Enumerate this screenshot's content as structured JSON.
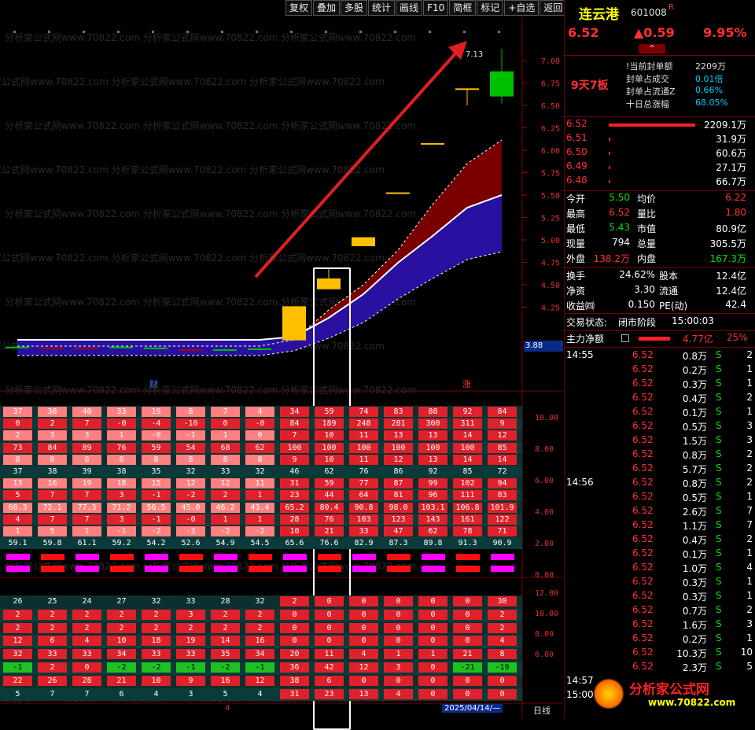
{
  "toolbar": {
    "items": [
      "复权",
      "叠加",
      "多股",
      "统计",
      "画线",
      "F10",
      "简框",
      "标记",
      "+自选",
      "返回"
    ]
  },
  "stock": {
    "name": "连云港",
    "code": "601008",
    "flag": "R",
    "price": "6.52",
    "change": "▲0.59",
    "pct": "9.95%"
  },
  "board": {
    "label": "9天7板",
    "rows": [
      {
        "k": "!当前封单额",
        "v": "2209万"
      },
      {
        "k": "封单占成交",
        "v": "0.01倍"
      },
      {
        "k": "封单占流通Z",
        "v": "0.66%"
      },
      {
        "k": "十日总涨幅",
        "v": "68.05%"
      }
    ]
  },
  "orderbook": [
    {
      "price": "6.52",
      "vol": "2209.1万"
    },
    {
      "price": "6.51",
      "vol": "31.9万"
    },
    {
      "price": "6.50",
      "vol": "60.6万"
    },
    {
      "price": "6.49",
      "vol": "27.1万"
    },
    {
      "price": "6.48",
      "vol": "66.7万"
    }
  ],
  "quote": [
    {
      "k1": "今开",
      "v1": "5.50",
      "k2": "均价",
      "v2": "6.22"
    },
    {
      "k1": "最高",
      "v1": "6.52",
      "k2": "量比",
      "v2": "1.80"
    },
    {
      "k1": "最低",
      "v1": "5.43",
      "k2": "市值",
      "v2": "80.9亿"
    },
    {
      "k1": "现量",
      "v1": "794",
      "k2": "总量",
      "v2": "305.5万"
    },
    {
      "k1": "外盘",
      "v1": "138.2万",
      "k2": "内盘",
      "v2": "167.3万"
    }
  ],
  "fund": [
    {
      "k1": "换手",
      "v1": "24.62%",
      "k2": "股本",
      "v2": "12.4亿"
    },
    {
      "k1": "净资",
      "v1": "3.30",
      "k2": "流通",
      "v2": "12.4亿"
    },
    {
      "k1": "收益㈣",
      "v1": "0.150",
      "k2": "PE(动)",
      "v2": "42.4"
    }
  ],
  "status": {
    "label": "交易状态:",
    "value": "闭市阶段",
    "time": "15:00:03"
  },
  "mainflow": {
    "label": "主力净额",
    "value": "4.77亿",
    "pct": "25%"
  },
  "ticks": [
    {
      "t": "14:55",
      "p": "6.52",
      "v": "0.8万",
      "s": "S",
      "n": "2"
    },
    {
      "t": "",
      "p": "6.52",
      "v": "0.2万",
      "s": "S",
      "n": "1"
    },
    {
      "t": "",
      "p": "6.52",
      "v": "0.3万",
      "s": "S",
      "n": "1"
    },
    {
      "t": "",
      "p": "6.52",
      "v": "0.4万",
      "s": "S",
      "n": "2"
    },
    {
      "t": "",
      "p": "6.52",
      "v": "0.1万",
      "s": "S",
      "n": "1"
    },
    {
      "t": "",
      "p": "6.52",
      "v": "0.5万",
      "s": "S",
      "n": "3"
    },
    {
      "t": "",
      "p": "6.52",
      "v": "1.5万",
      "s": "S",
      "n": "3"
    },
    {
      "t": "",
      "p": "6.52",
      "v": "0.8万",
      "s": "S",
      "n": "2"
    },
    {
      "t": "",
      "p": "6.52",
      "v": "5.7万",
      "s": "S",
      "n": "2"
    },
    {
      "t": "14:56",
      "p": "6.52",
      "v": "0.8万",
      "s": "S",
      "n": "2"
    },
    {
      "t": "",
      "p": "6.52",
      "v": "0.5万",
      "s": "S",
      "n": "1"
    },
    {
      "t": "",
      "p": "6.52",
      "v": "2.6万",
      "s": "S",
      "n": "7"
    },
    {
      "t": "",
      "p": "6.52",
      "v": "1.1万",
      "s": "S",
      "n": "7"
    },
    {
      "t": "",
      "p": "6.52",
      "v": "0.4万",
      "s": "S",
      "n": "2"
    },
    {
      "t": "",
      "p": "6.52",
      "v": "0.1万",
      "s": "S",
      "n": "1"
    },
    {
      "t": "",
      "p": "6.52",
      "v": "1.0万",
      "s": "S",
      "n": "4"
    },
    {
      "t": "",
      "p": "6.52",
      "v": "0.3万",
      "s": "S",
      "n": "1"
    },
    {
      "t": "",
      "p": "6.52",
      "v": "0.3万",
      "s": "S",
      "n": "1"
    },
    {
      "t": "",
      "p": "6.52",
      "v": "0.7万",
      "s": "S",
      "n": "2"
    },
    {
      "t": "",
      "p": "6.52",
      "v": "1.6万",
      "s": "S",
      "n": "3"
    },
    {
      "t": "",
      "p": "6.52",
      "v": "0.2万",
      "s": "S",
      "n": "1"
    },
    {
      "t": "",
      "p": "6.52",
      "v": "10.3万",
      "s": "S",
      "n": "10"
    },
    {
      "t": "",
      "p": "6.52",
      "v": "2.3万",
      "s": "S",
      "n": "5"
    },
    {
      "t": "14:57",
      "p": "",
      "v": "",
      "s": "",
      "n": ""
    },
    {
      "t": "15:00",
      "p": "",
      "v": "",
      "s": "",
      "n": ""
    }
  ],
  "price_axis": [
    "7.00",
    "6.75",
    "6.50",
    "6.25",
    "6.00",
    "5.75",
    "5.50",
    "5.25",
    "5.00",
    "4.75",
    "4.50",
    "4.25"
  ],
  "price_current": "3.88",
  "max_label": "7.13",
  "markers": {
    "cai": "财",
    "zhang": "涨"
  },
  "grid1_axis": [
    "10.00",
    "8.00",
    "6.00",
    "4.00",
    "2.00",
    "0.00"
  ],
  "grid2_axis": [
    "12.00",
    "10.00",
    "8.00",
    "6.00"
  ],
  "grid1": [
    [
      "37",
      "38",
      "40",
      "33",
      "19",
      "8",
      "7",
      "4",
      "34",
      "59",
      "74",
      "83",
      "88",
      "92",
      "84"
    ],
    [
      "0",
      "2",
      "7",
      "-0",
      "-4",
      "-10",
      "0",
      "-0",
      "84",
      "189",
      "248",
      "281",
      "300",
      "311",
      "9"
    ],
    [
      "2",
      "3",
      "3",
      "1",
      "-0",
      "-1",
      "1",
      "0",
      "7",
      "10",
      "11",
      "13",
      "13",
      "14",
      "12"
    ],
    [
      "73",
      "84",
      "89",
      "76",
      "59",
      "54",
      "68",
      "62",
      "100",
      "100",
      "100",
      "100",
      "100",
      "100",
      "85"
    ],
    [
      "8",
      "8",
      "8",
      "8",
      "8",
      "8",
      "8",
      "8",
      "9",
      "10",
      "11",
      "12",
      "13",
      "14",
      "14"
    ],
    [
      "37",
      "38",
      "39",
      "38",
      "35",
      "32",
      "33",
      "32",
      "46",
      "62",
      "76",
      "86",
      "92",
      "85",
      "72"
    ],
    [
      "13",
      "16",
      "19",
      "18",
      "15",
      "12",
      "12",
      "11",
      "31",
      "59",
      "77",
      "87",
      "99",
      "102",
      "94"
    ],
    [
      "5",
      "7",
      "7",
      "3",
      "-1",
      "-2",
      "2",
      "1",
      "23",
      "44",
      "64",
      "81",
      "96",
      "111",
      "83"
    ],
    [
      "68.3",
      "72.1",
      "77.3",
      "71.2",
      "56.5",
      "45.0",
      "46.2",
      "43.4",
      "65.2",
      "80.4",
      "90.8",
      "98.0",
      "103.1",
      "106.8",
      "101.9"
    ],
    [
      "4",
      "7",
      "7",
      "3",
      "-1",
      "-0",
      "1",
      "1",
      "28",
      "76",
      "103",
      "123",
      "143",
      "161",
      "122"
    ],
    [
      "1",
      "5",
      "1",
      "-1",
      "-2",
      "-3",
      "-2",
      "-2",
      "10",
      "21",
      "33",
      "47",
      "62",
      "78",
      "71"
    ],
    [
      "59.1",
      "59.8",
      "61.1",
      "59.2",
      "54.2",
      "52.6",
      "54.9",
      "54.5",
      "65.6",
      "76.6",
      "82.9",
      "87.3",
      "89.8",
      "91.3",
      "90.9"
    ]
  ],
  "grid2": [
    [
      "26",
      "25",
      "24",
      "27",
      "32",
      "33",
      "28",
      "32",
      "2",
      "0",
      "0",
      "0",
      "0",
      "0",
      "30"
    ],
    [
      "2",
      "2",
      "2",
      "2",
      "2",
      "3",
      "2",
      "2",
      "0",
      "0",
      "0",
      "0",
      "0",
      "0",
      "2"
    ],
    [
      "2",
      "2",
      "2",
      "2",
      "2",
      "2",
      "2",
      "2",
      "0",
      "0",
      "0",
      "0",
      "0",
      "0",
      "2"
    ],
    [
      "12",
      "6",
      "4",
      "10",
      "18",
      "19",
      "14",
      "16",
      "0",
      "0",
      "0",
      "0",
      "0",
      "0",
      "4"
    ],
    [
      "32",
      "33",
      "33",
      "34",
      "33",
      "33",
      "35",
      "34",
      "20",
      "11",
      "4",
      "1",
      "1",
      "21",
      "8"
    ],
    [
      "-1",
      "2",
      "0",
      "-2",
      "-2",
      "-1",
      "-2",
      "-1",
      "36",
      "42",
      "12",
      "3",
      "0",
      "-21",
      "-19"
    ],
    [
      "22",
      "26",
      "28",
      "21",
      "10",
      "9",
      "16",
      "12",
      "38",
      "6",
      "0",
      "0",
      "0",
      "0",
      "0"
    ],
    [
      "5",
      "7",
      "7",
      "6",
      "4",
      "3",
      "5",
      "4",
      "31",
      "23",
      "13",
      "4",
      "0",
      "0",
      "0"
    ]
  ],
  "footer": {
    "date": "2025/04/14/—",
    "period": "日线",
    "mark": "4"
  },
  "logo": {
    "text": "分析家公式网",
    "url": "www.70822.com"
  },
  "watermark": "分析家公式网www.70822.com",
  "colors": {
    "up": "#ff2020",
    "down": "#00d000",
    "accent": "#ffff00",
    "cloud_red": "#7a0000",
    "cloud_blue": "#2a10a0"
  }
}
